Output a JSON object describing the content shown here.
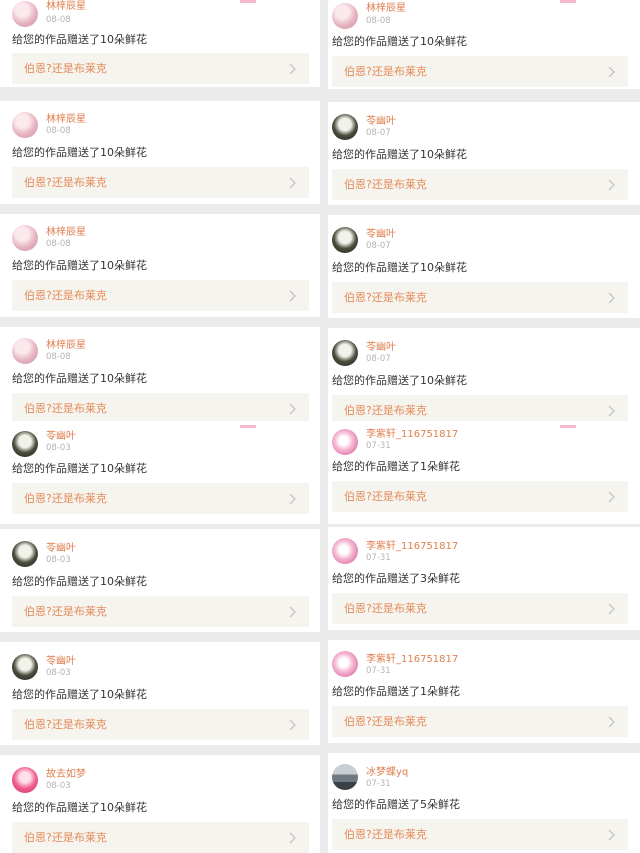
{
  "left_column": [
    {
      "avatar_icon": "avatar-pink-anime",
      "nickname": "林梓辰星",
      "date": "08-08",
      "message": "给您的作品赠送了10朵鲜花",
      "work_title": "伯恩?还是布莱克"
    },
    {
      "avatar_icon": "avatar-pink-anime",
      "nickname": "林梓辰星",
      "date": "08-08",
      "message": "给您的作品赠送了10朵鲜花",
      "work_title": "伯恩?还是布莱克"
    },
    {
      "avatar_icon": "avatar-pink-anime",
      "nickname": "林梓辰星",
      "date": "08-08",
      "message": "给您的作品赠送了10朵鲜花",
      "work_title": "伯恩?还是布莱克"
    },
    {
      "avatar_icon": "avatar-pink-anime",
      "nickname": "林梓辰星",
      "date": "08-08",
      "message": "给您的作品赠送了10朵鲜花",
      "work_title": "伯恩?还是布莱克"
    },
    {
      "avatar_icon": "avatar-dark-photo",
      "nickname": "苓幽叶",
      "date": "08-03",
      "message": "给您的作品赠送了10朵鲜花",
      "work_title": "伯恩?还是布莱克"
    },
    {
      "avatar_icon": "avatar-dark-photo",
      "nickname": "苓幽叶",
      "date": "08-03",
      "message": "给您的作品赠送了10朵鲜花",
      "work_title": "伯恩?还是布莱克"
    },
    {
      "avatar_icon": "avatar-dark-photo",
      "nickname": "苓幽叶",
      "date": "08-03",
      "message": "给您的作品赠送了10朵鲜花",
      "work_title": "伯恩?还是布莱克"
    },
    {
      "avatar_icon": "avatar-red-anime",
      "nickname": "故去如梦",
      "date": "08-03",
      "message": "给您的作品赠送了10朵鲜花",
      "work_title": "伯恩?还是布莱克"
    }
  ],
  "right_column": [
    {
      "avatar_icon": "avatar-pink-anime",
      "nickname": "林梓辰星",
      "date": "08-08",
      "message": "给您的作品赠送了10朵鲜花",
      "work_title": "伯恩?还是布莱克"
    },
    {
      "avatar_icon": "avatar-dark-photo",
      "nickname": "苓幽叶",
      "date": "08-07",
      "message": "给您的作品赠送了10朵鲜花",
      "work_title": "伯恩?还是布莱克"
    },
    {
      "avatar_icon": "avatar-dark-photo",
      "nickname": "苓幽叶",
      "date": "08-07",
      "message": "给您的作品赠送了10朵鲜花",
      "work_title": "伯恩?还是布莱克"
    },
    {
      "avatar_icon": "avatar-dark-photo",
      "nickname": "苓幽叶",
      "date": "08-07",
      "message": "给您的作品赠送了10朵鲜花",
      "work_title": "伯恩?还是布莱克"
    },
    {
      "avatar_icon": "avatar-flower",
      "nickname": "李紫轩_116751817",
      "date": "07-31",
      "message": "给您的作品赠送了1朵鲜花",
      "work_title": "伯恩?还是布莱克"
    },
    {
      "avatar_icon": "avatar-flower",
      "nickname": "李紫轩_116751817",
      "date": "07-31",
      "message": "给您的作品赠送了3朵鲜花",
      "work_title": "伯恩?还是布莱克"
    },
    {
      "avatar_icon": "avatar-flower",
      "nickname": "李紫轩_116751817",
      "date": "07-31",
      "message": "给您的作品赠送了1朵鲜花",
      "work_title": "伯恩?还是布莱克"
    },
    {
      "avatar_icon": "avatar-scenery",
      "nickname": "冰梦蝶yq",
      "date": "07-31",
      "message": "给您的作品赠送了5朵鲜花",
      "work_title": "伯恩?还是布莱克"
    }
  ],
  "colors": {
    "nickname": "#e0804f",
    "date": "#b4b4b4",
    "message": "#333333",
    "work_title": "#e48b5a",
    "reference_bg": "#f6f4ef",
    "divider": "#ebebeb"
  }
}
